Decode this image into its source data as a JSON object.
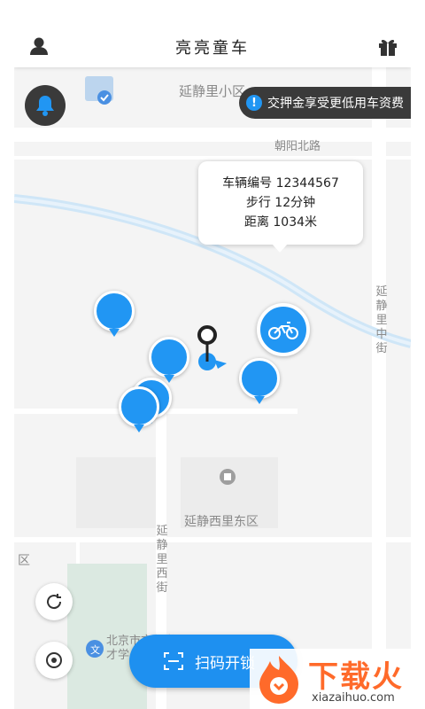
{
  "header": {
    "title": "亮亮童车",
    "user_icon": "user-icon",
    "gift_icon": "gift-icon"
  },
  "notice": {
    "text": "交押金享受更低用车资费"
  },
  "map_labels": {
    "area_top": "延静里小区",
    "road_chaoyang": "朝阳北路",
    "street_right": "延静里中街",
    "area_mid": "延静西里东区",
    "street_mid": "延静里西街",
    "area_left": "区",
    "school": "北京市文化学",
    "school_line2": "才学"
  },
  "bike_info": {
    "id_line": "车辆编号 12344567",
    "walk_line": "步行 12分钟",
    "distance_line": "距离 1034米"
  },
  "scan_button": {
    "label": "扫码开锁"
  },
  "watermark": {
    "brand": "下载火",
    "url": "xiazaihuo.com"
  },
  "colors": {
    "accent": "#2196f3",
    "dark_pill": "#3a3a3a"
  }
}
